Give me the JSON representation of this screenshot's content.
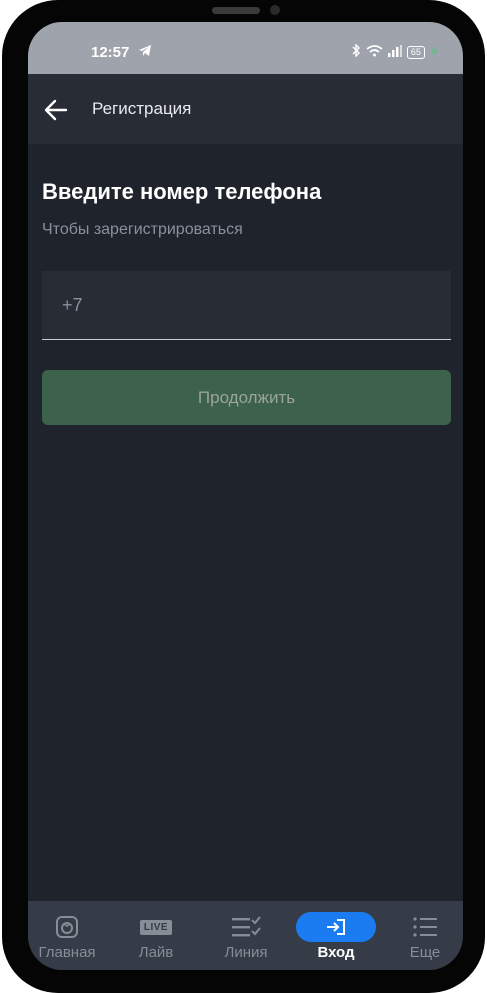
{
  "status_bar": {
    "time": "12:57",
    "battery": "65",
    "icons": [
      "telegram-icon",
      "bluetooth-icon",
      "wifi-icon",
      "signal-icon",
      "battery-icon",
      "charging-icon"
    ]
  },
  "app_bar": {
    "title": "Регистрация",
    "back_icon": "arrow-left-icon"
  },
  "form": {
    "heading": "Введите номер телефона",
    "subtitle": "Чтобы зарегистрироваться",
    "phone_prefix": "+7",
    "phone_value": "",
    "continue_label": "Продолжить"
  },
  "bottom_nav": {
    "items": [
      {
        "label": "Главная",
        "icon": "home-ball-icon",
        "active": false
      },
      {
        "label": "Лайв",
        "icon": "live-icon",
        "badge": "LIVE",
        "active": false
      },
      {
        "label": "Линия",
        "icon": "list-check-icon",
        "active": false
      },
      {
        "label": "Вход",
        "icon": "login-icon",
        "active": true
      },
      {
        "label": "Еще",
        "icon": "menu-icon",
        "active": false
      }
    ]
  },
  "colors": {
    "background": "#1e232c",
    "app_bar": "#272c35",
    "button": "#3d624b",
    "accent": "#1b7cf2",
    "nav": "#353c47"
  }
}
